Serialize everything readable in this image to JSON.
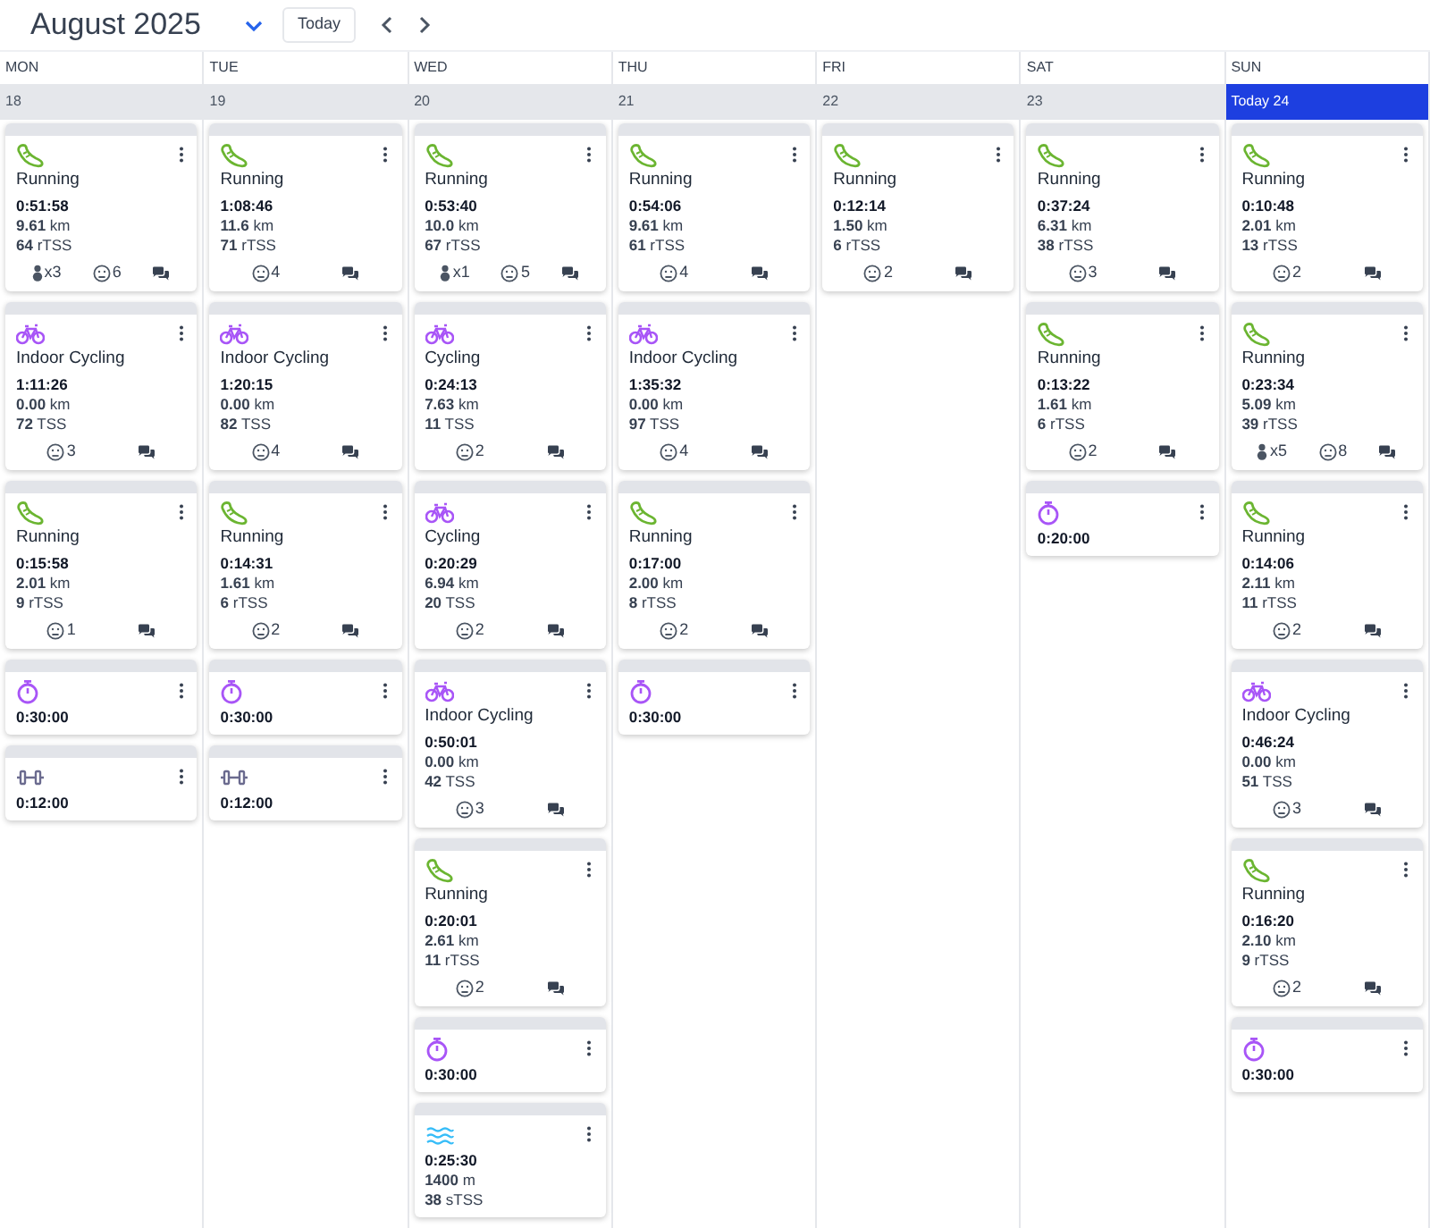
{
  "header": {
    "title": "August 2025",
    "today_button": "Today"
  },
  "days": [
    {
      "weekday": "MON",
      "date": "18",
      "today": false,
      "activities": [
        {
          "kind": "run",
          "title": "Running",
          "duration": "0:51:58",
          "lines": [
            "**9.61** km",
            "**64** rTSS"
          ],
          "medals": "x3",
          "feel": "6",
          "comments": true
        },
        {
          "kind": "bike",
          "title": "Indoor Cycling",
          "duration": "1:11:26",
          "lines": [
            "**0.00** km",
            "**72** TSS"
          ],
          "feel": "3",
          "comments": true
        },
        {
          "kind": "run",
          "title": "Running",
          "duration": "0:15:58",
          "lines": [
            "**2.01** km",
            "**9** rTSS"
          ],
          "feel": "1",
          "comments": true
        },
        {
          "kind": "timer",
          "duration": "0:30:00"
        },
        {
          "kind": "strength",
          "duration": "0:12:00"
        }
      ]
    },
    {
      "weekday": "TUE",
      "date": "19",
      "today": false,
      "activities": [
        {
          "kind": "run",
          "title": "Running",
          "duration": "1:08:46",
          "lines": [
            "**11.6** km",
            "**71** rTSS"
          ],
          "feel": "4",
          "comments": true
        },
        {
          "kind": "bike",
          "title": "Indoor Cycling",
          "duration": "1:20:15",
          "lines": [
            "**0.00** km",
            "**82** TSS"
          ],
          "feel": "4",
          "comments": true
        },
        {
          "kind": "run",
          "title": "Running",
          "duration": "0:14:31",
          "lines": [
            "**1.61** km",
            "**6** rTSS"
          ],
          "feel": "2",
          "comments": true
        },
        {
          "kind": "timer",
          "duration": "0:30:00"
        },
        {
          "kind": "strength",
          "duration": "0:12:00"
        }
      ]
    },
    {
      "weekday": "WED",
      "date": "20",
      "today": false,
      "activities": [
        {
          "kind": "run",
          "title": "Running",
          "duration": "0:53:40",
          "lines": [
            "**10.0** km",
            "**67** rTSS"
          ],
          "medals": "x1",
          "feel": "5",
          "comments": true
        },
        {
          "kind": "bike",
          "title": "Cycling",
          "duration": "0:24:13",
          "lines": [
            "**7.63** km",
            "**11** TSS"
          ],
          "feel": "2",
          "comments": true
        },
        {
          "kind": "bike",
          "title": "Cycling",
          "duration": "0:20:29",
          "lines": [
            "**6.94** km",
            "**20** TSS"
          ],
          "feel": "2",
          "comments": true
        },
        {
          "kind": "bike",
          "title": "Indoor Cycling",
          "duration": "0:50:01",
          "lines": [
            "**0.00** km",
            "**42** TSS"
          ],
          "feel": "3",
          "comments": true
        },
        {
          "kind": "run",
          "title": "Running",
          "duration": "0:20:01",
          "lines": [
            "**2.61** km",
            "**11** rTSS"
          ],
          "feel": "2",
          "comments": true
        },
        {
          "kind": "timer",
          "duration": "0:30:00"
        },
        {
          "kind": "swim",
          "duration": "0:25:30",
          "lines": [
            "**1400** m",
            "**38** sTSS"
          ]
        }
      ]
    },
    {
      "weekday": "THU",
      "date": "21",
      "today": false,
      "activities": [
        {
          "kind": "run",
          "title": "Running",
          "duration": "0:54:06",
          "lines": [
            "**9.61** km",
            "**61** rTSS"
          ],
          "feel": "4",
          "comments": true
        },
        {
          "kind": "bike",
          "title": "Indoor Cycling",
          "duration": "1:35:32",
          "lines": [
            "**0.00** km",
            "**97** TSS"
          ],
          "feel": "4",
          "comments": true
        },
        {
          "kind": "run",
          "title": "Running",
          "duration": "0:17:00",
          "lines": [
            "**2.00** km",
            "**8** rTSS"
          ],
          "feel": "2",
          "comments": true
        },
        {
          "kind": "timer",
          "duration": "0:30:00"
        }
      ]
    },
    {
      "weekday": "FRI",
      "date": "22",
      "today": false,
      "activities": [
        {
          "kind": "run",
          "title": "Running",
          "duration": "0:12:14",
          "lines": [
            "**1.50** km",
            "**6** rTSS"
          ],
          "feel": "2",
          "comments": true
        }
      ]
    },
    {
      "weekday": "SAT",
      "date": "23",
      "today": false,
      "activities": [
        {
          "kind": "run",
          "title": "Running",
          "duration": "0:37:24",
          "lines": [
            "**6.31** km",
            "**38** rTSS"
          ],
          "feel": "3",
          "comments": true
        },
        {
          "kind": "run",
          "title": "Running",
          "duration": "0:13:22",
          "lines": [
            "**1.61** km",
            "**6** rTSS"
          ],
          "feel": "2",
          "comments": true
        },
        {
          "kind": "timer",
          "duration": "0:20:00"
        }
      ]
    },
    {
      "weekday": "SUN",
      "date": "Today 24",
      "today": true,
      "activities": [
        {
          "kind": "run",
          "title": "Running",
          "duration": "0:10:48",
          "lines": [
            "**2.01** km",
            "**13** rTSS"
          ],
          "feel": "2",
          "comments": true
        },
        {
          "kind": "run",
          "title": "Running",
          "duration": "0:23:34",
          "lines": [
            "**5.09** km",
            "**39** rTSS"
          ],
          "medals": "x5",
          "feel": "8",
          "comments": true
        },
        {
          "kind": "run",
          "title": "Running",
          "duration": "0:14:06",
          "lines": [
            "**2.11** km",
            "**11** rTSS"
          ],
          "feel": "2",
          "comments": true
        },
        {
          "kind": "bike",
          "title": "Indoor Cycling",
          "duration": "0:46:24",
          "lines": [
            "**0.00** km",
            "**51** TSS"
          ],
          "feel": "3",
          "comments": true
        },
        {
          "kind": "run",
          "title": "Running",
          "duration": "0:16:20",
          "lines": [
            "**2.10** km",
            "**9** rTSS"
          ],
          "feel": "2",
          "comments": true
        },
        {
          "kind": "timer",
          "duration": "0:30:00"
        }
      ]
    }
  ]
}
